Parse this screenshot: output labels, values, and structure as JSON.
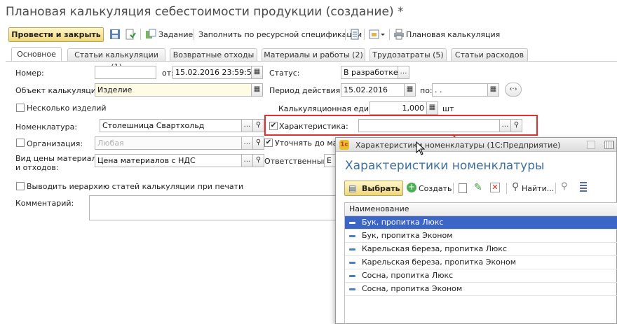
{
  "window": {
    "title": "Плановая калькуляция себестоимости продукции (создание) *"
  },
  "toolbar": {
    "post_close": "Провести и закрыть",
    "task": "Задание",
    "fill_spec": "Заполнить по ресурсной спецификации",
    "print_calc": "Плановая калькуляция"
  },
  "tabs": [
    {
      "label": "Основное"
    },
    {
      "label": "Статьи калькуляции (1)"
    },
    {
      "label": "Возвратные отходы"
    },
    {
      "label": "Материалы и работы (2)"
    },
    {
      "label": "Трудозатраты (5)"
    },
    {
      "label": "Статьи расходов"
    }
  ],
  "form": {
    "number_label": "Номер:",
    "number_value": "",
    "from_label": "от:",
    "date_value": "15.02.2016 23:59:59",
    "status_label": "Статус:",
    "status_value": "В разработке",
    "object_label": "Объект калькуляции:",
    "object_value": "Изделие",
    "period_label": "Период действия с:",
    "period_from": "15.02.2016",
    "period_to_label": "по:",
    "period_to": " .  .",
    "several_label": "Несколько изделий",
    "unit_label": "Калькуляционная единица",
    "unit_value": "1,000",
    "unit_measure": "шт",
    "nomenclature_label": "Номенклатура:",
    "nomenclature_value": "Столешница Свартхольд",
    "characteristic_label": "Характеристика:",
    "characteristic_value": "",
    "org_label": "Организация:",
    "org_value": "Любая",
    "refine_label": "Уточнять до мате",
    "price_type_label": "Вид цены материалов\nи отходов:",
    "price_type_line1": "Вид цены материалов",
    "price_type_line2": "и отходов:",
    "price_type_value": "Цена материалов с НДС",
    "responsible_label": "Ответственный:",
    "responsible_value": "E",
    "hierarchy_label": "Выводить иерархию статей калькуляции при печати",
    "comment_label": "Комментарий:"
  },
  "popup": {
    "titlebar": "Характеристики номенклатуры  (1С:Предприятие)",
    "header": "Характеристики номенклатуры",
    "select": "Выбрать",
    "create": "Создать",
    "find": "Найти...",
    "column": "Наименование",
    "rows": [
      "Бук, пропитка Люкс",
      "Бук, пропитка Эконом",
      "Карельская береза, пропитка Люкс",
      "Карельская береза, пропитка Эконом",
      "Сосна, пропитка Люкс",
      "Сосна, пропитка Эконом"
    ],
    "selected_index": 0
  },
  "colors": {
    "accent_red": "#e03030",
    "selection": "#3b66c8",
    "header_blue": "#3e6fa0"
  }
}
